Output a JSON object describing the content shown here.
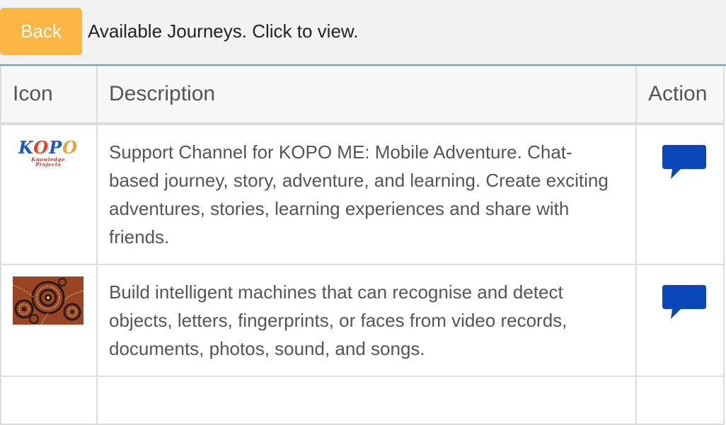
{
  "header": {
    "back_label": "Back",
    "title": "Available Journeys. Click to view."
  },
  "table": {
    "columns": [
      "Icon",
      "Description",
      "Action"
    ],
    "rows": [
      {
        "icon": {
          "name": "kopo-logo",
          "text": "KOPO",
          "subtext": "Knowledge Projects"
        },
        "description": "Support Channel for KOPO ME: Mobile Adventure. Chat-based journey, story, adventure, and learning. Create exciting adventures, stories, learning experiences and share with friends.",
        "action_icon": "chat-bubble-icon"
      },
      {
        "icon": {
          "name": "aboriginal-dot-art-thumbnail"
        },
        "description": "Build intelligent machines that can recognise and detect objects, letters, fingerprints, or faces from video records, documents, photos, sound, and songs.",
        "action_icon": "chat-bubble-icon"
      }
    ]
  },
  "colors": {
    "back_button": "#fdb643",
    "header_border": "#5b9bd5",
    "action_icon": "#0b47b8",
    "kopo_letters": [
      "#1a56c4",
      "#e8431f",
      "#1a56c4",
      "#f0a030"
    ]
  }
}
